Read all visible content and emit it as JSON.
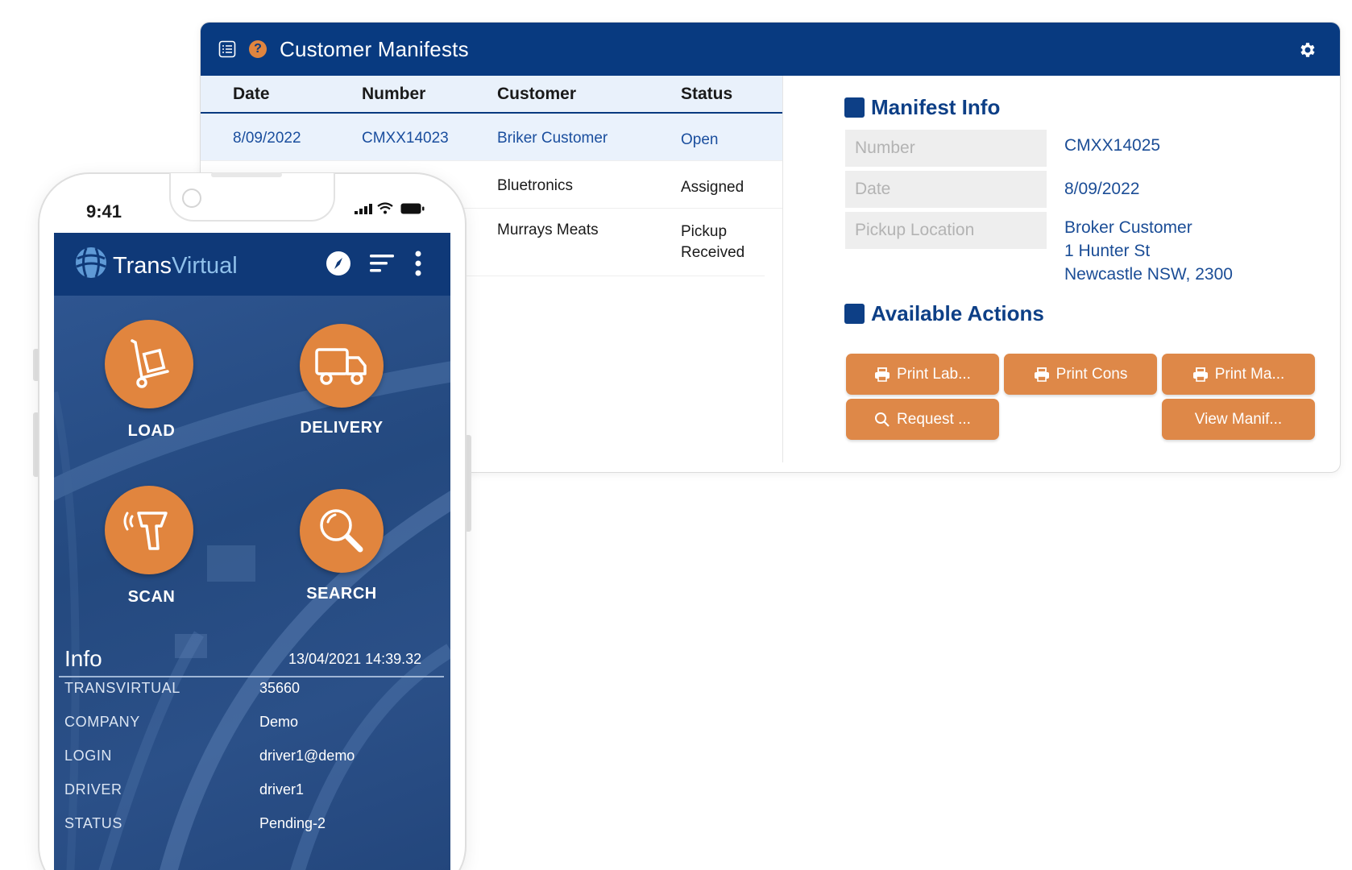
{
  "window": {
    "title": "Customer Manifests",
    "help_icon": "?"
  },
  "table": {
    "headers": [
      "Date",
      "Number",
      "Customer",
      "Status"
    ],
    "rows": [
      {
        "date": "8/09/2022",
        "number": "CMXX14023",
        "customer": "Briker Customer",
        "status": "Open"
      },
      {
        "date": "",
        "number": "",
        "customer": "Bluetronics",
        "status": "Assigned"
      },
      {
        "date": "",
        "number": "",
        "customer": "Murrays Meats",
        "status_line1": "Pickup",
        "status_line2": "Received"
      }
    ]
  },
  "manifest_info": {
    "title": "Manifest Info",
    "fields": [
      {
        "label": "Number",
        "value": "CMXX14025"
      },
      {
        "label": "Date",
        "value": "8/09/2022"
      },
      {
        "label": "Pickup Location",
        "value_lines": [
          "Broker Customer",
          "1 Hunter St",
          "Newcastle NSW, 2300"
        ]
      }
    ]
  },
  "actions": {
    "title": "Available Actions",
    "buttons": [
      "Print Lab...",
      "Print Cons",
      "Print Ma...",
      "Request ...",
      "View Manif..."
    ]
  },
  "phone": {
    "time": "9:41",
    "logo_trans": "Trans",
    "logo_virtual": "Virtual",
    "tiles": [
      "LOAD",
      "DELIVERY",
      "SCAN",
      "SEARCH"
    ],
    "info_title": "Info",
    "info_timestamp": "13/04/2021 14:39.32",
    "info_rows": [
      {
        "key": "TRANSVIRTUAL",
        "value": "35660"
      },
      {
        "key": "COMPANY",
        "value": "Demo"
      },
      {
        "key": "LOGIN",
        "value": "driver1@demo"
      },
      {
        "key": "DRIVER",
        "value": "driver1"
      },
      {
        "key": "STATUS",
        "value": "Pending-2"
      }
    ]
  },
  "colors": {
    "brand_navy": "#083a80",
    "accent_orange": "#de8848",
    "link_blue": "#1b4d96"
  },
  "icons": [
    "list-icon",
    "help-icon",
    "gear-icon",
    "printer-icon",
    "search-icon",
    "compass-icon",
    "filter-icon",
    "more-vert-icon",
    "hand-truck-icon",
    "truck-icon",
    "scanner-icon",
    "magnifier-icon",
    "globe-logo-icon",
    "signal-icon",
    "wifi-icon",
    "battery-icon"
  ]
}
